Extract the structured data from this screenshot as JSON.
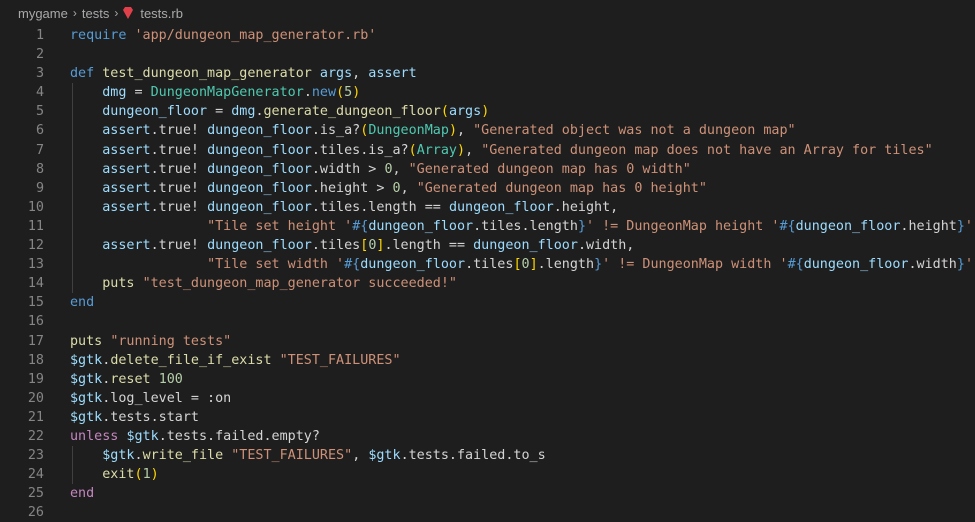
{
  "breadcrumb": {
    "items": [
      "mygame",
      "tests"
    ],
    "file": "tests.rb",
    "file_icon": "ruby-gem-icon"
  },
  "lines": [
    {
      "n": "1",
      "tokens": [
        [
          "kwb",
          "require"
        ],
        [
          "plain",
          " "
        ],
        [
          "str",
          "'app/dungeon_map_generator.rb'"
        ]
      ]
    },
    {
      "n": "2",
      "tokens": []
    },
    {
      "n": "3",
      "tokens": [
        [
          "kwb",
          "def"
        ],
        [
          "plain",
          " "
        ],
        [
          "fn",
          "test_dungeon_map_generator"
        ],
        [
          "plain",
          " "
        ],
        [
          "var",
          "args"
        ],
        [
          "plain",
          ", "
        ],
        [
          "var",
          "assert"
        ]
      ]
    },
    {
      "n": "4",
      "tokens": [
        [
          "plain",
          "    "
        ],
        [
          "var",
          "dmg"
        ],
        [
          "plain",
          " = "
        ],
        [
          "cls",
          "DungeonMapGenerator"
        ],
        [
          "plain",
          "."
        ],
        [
          "kwb",
          "new"
        ],
        [
          "brk",
          "("
        ],
        [
          "num",
          "5"
        ],
        [
          "brk",
          ")"
        ]
      ]
    },
    {
      "n": "5",
      "tokens": [
        [
          "plain",
          "    "
        ],
        [
          "var",
          "dungeon_floor"
        ],
        [
          "plain",
          " = "
        ],
        [
          "var",
          "dmg"
        ],
        [
          "plain",
          "."
        ],
        [
          "fn",
          "generate_dungeon_floor"
        ],
        [
          "brk",
          "("
        ],
        [
          "var",
          "args"
        ],
        [
          "brk",
          ")"
        ]
      ]
    },
    {
      "n": "6",
      "tokens": [
        [
          "plain",
          "    "
        ],
        [
          "var",
          "assert"
        ],
        [
          "plain",
          ".true! "
        ],
        [
          "var",
          "dungeon_floor"
        ],
        [
          "plain",
          ".is_a?"
        ],
        [
          "brk",
          "("
        ],
        [
          "cls",
          "DungeonMap"
        ],
        [
          "brk",
          ")"
        ],
        [
          "plain",
          ", "
        ],
        [
          "str",
          "\"Generated object was not a dungeon map\""
        ]
      ]
    },
    {
      "n": "7",
      "tokens": [
        [
          "plain",
          "    "
        ],
        [
          "var",
          "assert"
        ],
        [
          "plain",
          ".true! "
        ],
        [
          "var",
          "dungeon_floor"
        ],
        [
          "plain",
          ".tiles.is_a?"
        ],
        [
          "brk",
          "("
        ],
        [
          "cls",
          "Array"
        ],
        [
          "brk",
          ")"
        ],
        [
          "plain",
          ", "
        ],
        [
          "str",
          "\"Generated dungeon map does not have an Array for tiles\""
        ]
      ]
    },
    {
      "n": "8",
      "tokens": [
        [
          "plain",
          "    "
        ],
        [
          "var",
          "assert"
        ],
        [
          "plain",
          ".true! "
        ],
        [
          "var",
          "dungeon_floor"
        ],
        [
          "plain",
          ".width > "
        ],
        [
          "num",
          "0"
        ],
        [
          "plain",
          ", "
        ],
        [
          "str",
          "\"Generated dungeon map has 0 width\""
        ]
      ]
    },
    {
      "n": "9",
      "tokens": [
        [
          "plain",
          "    "
        ],
        [
          "var",
          "assert"
        ],
        [
          "plain",
          ".true! "
        ],
        [
          "var",
          "dungeon_floor"
        ],
        [
          "plain",
          ".height > "
        ],
        [
          "num",
          "0"
        ],
        [
          "plain",
          ", "
        ],
        [
          "str",
          "\"Generated dungeon map has 0 height\""
        ]
      ]
    },
    {
      "n": "10",
      "tokens": [
        [
          "plain",
          "    "
        ],
        [
          "var",
          "assert"
        ],
        [
          "plain",
          ".true! "
        ],
        [
          "var",
          "dungeon_floor"
        ],
        [
          "plain",
          ".tiles.length == "
        ],
        [
          "var",
          "dungeon_floor"
        ],
        [
          "plain",
          ".height,"
        ]
      ]
    },
    {
      "n": "11",
      "tokens": [
        [
          "plain",
          "                 "
        ],
        [
          "str",
          "\"Tile set height '"
        ],
        [
          "interp",
          "#{"
        ],
        [
          "var",
          "dungeon_floor"
        ],
        [
          "plain",
          ".tiles.length"
        ],
        [
          "interp",
          "}"
        ],
        [
          "str",
          "' != DungeonMap height '"
        ],
        [
          "interp",
          "#{"
        ],
        [
          "var",
          "dungeon_floor"
        ],
        [
          "plain",
          ".height"
        ],
        [
          "interp",
          "}"
        ],
        [
          "str",
          "'\""
        ]
      ]
    },
    {
      "n": "12",
      "tokens": [
        [
          "plain",
          "    "
        ],
        [
          "var",
          "assert"
        ],
        [
          "plain",
          ".true! "
        ],
        [
          "var",
          "dungeon_floor"
        ],
        [
          "plain",
          ".tiles"
        ],
        [
          "brk",
          "["
        ],
        [
          "num",
          "0"
        ],
        [
          "brk",
          "]"
        ],
        [
          "plain",
          ".length == "
        ],
        [
          "var",
          "dungeon_floor"
        ],
        [
          "plain",
          ".width,"
        ]
      ]
    },
    {
      "n": "13",
      "tokens": [
        [
          "plain",
          "                 "
        ],
        [
          "str",
          "\"Tile set width '"
        ],
        [
          "interp",
          "#{"
        ],
        [
          "var",
          "dungeon_floor"
        ],
        [
          "plain",
          ".tiles"
        ],
        [
          "brk",
          "["
        ],
        [
          "num",
          "0"
        ],
        [
          "brk",
          "]"
        ],
        [
          "plain",
          ".length"
        ],
        [
          "interp",
          "}"
        ],
        [
          "str",
          "' != DungeonMap width '"
        ],
        [
          "interp",
          "#{"
        ],
        [
          "var",
          "dungeon_floor"
        ],
        [
          "plain",
          ".width"
        ],
        [
          "interp",
          "}"
        ],
        [
          "str",
          "'\""
        ]
      ]
    },
    {
      "n": "14",
      "tokens": [
        [
          "plain",
          "    "
        ],
        [
          "fn",
          "puts"
        ],
        [
          "plain",
          " "
        ],
        [
          "str",
          "\"test_dungeon_map_generator succeeded!\""
        ]
      ]
    },
    {
      "n": "15",
      "tokens": [
        [
          "kwb",
          "end"
        ]
      ]
    },
    {
      "n": "16",
      "tokens": []
    },
    {
      "n": "17",
      "tokens": [
        [
          "fn",
          "puts"
        ],
        [
          "plain",
          " "
        ],
        [
          "str",
          "\"running tests\""
        ]
      ]
    },
    {
      "n": "18",
      "tokens": [
        [
          "var",
          "$gtk"
        ],
        [
          "plain",
          "."
        ],
        [
          "fn",
          "delete_file_if_exist"
        ],
        [
          "plain",
          " "
        ],
        [
          "str",
          "\"TEST_FAILURES\""
        ]
      ]
    },
    {
      "n": "19",
      "tokens": [
        [
          "var",
          "$gtk"
        ],
        [
          "plain",
          "."
        ],
        [
          "fn",
          "reset"
        ],
        [
          "plain",
          " "
        ],
        [
          "num",
          "100"
        ]
      ]
    },
    {
      "n": "20",
      "tokens": [
        [
          "var",
          "$gtk"
        ],
        [
          "plain",
          ".log_level = :on"
        ]
      ]
    },
    {
      "n": "21",
      "tokens": [
        [
          "var",
          "$gtk"
        ],
        [
          "plain",
          ".tests.start"
        ]
      ]
    },
    {
      "n": "22",
      "tokens": [
        [
          "kw",
          "unless"
        ],
        [
          "plain",
          " "
        ],
        [
          "var",
          "$gtk"
        ],
        [
          "plain",
          ".tests.failed.empty?"
        ]
      ]
    },
    {
      "n": "23",
      "tokens": [
        [
          "plain",
          "    "
        ],
        [
          "var",
          "$gtk"
        ],
        [
          "plain",
          "."
        ],
        [
          "fn",
          "write_file"
        ],
        [
          "plain",
          " "
        ],
        [
          "str",
          "\"TEST_FAILURES\""
        ],
        [
          "plain",
          ", "
        ],
        [
          "var",
          "$gtk"
        ],
        [
          "plain",
          ".tests.failed.to_s"
        ]
      ]
    },
    {
      "n": "24",
      "tokens": [
        [
          "plain",
          "    "
        ],
        [
          "fn",
          "exit"
        ],
        [
          "brk",
          "("
        ],
        [
          "num",
          "1"
        ],
        [
          "brk",
          ")"
        ]
      ]
    },
    {
      "n": "25",
      "tokens": [
        [
          "kw",
          "end"
        ]
      ]
    },
    {
      "n": "26",
      "tokens": []
    }
  ]
}
